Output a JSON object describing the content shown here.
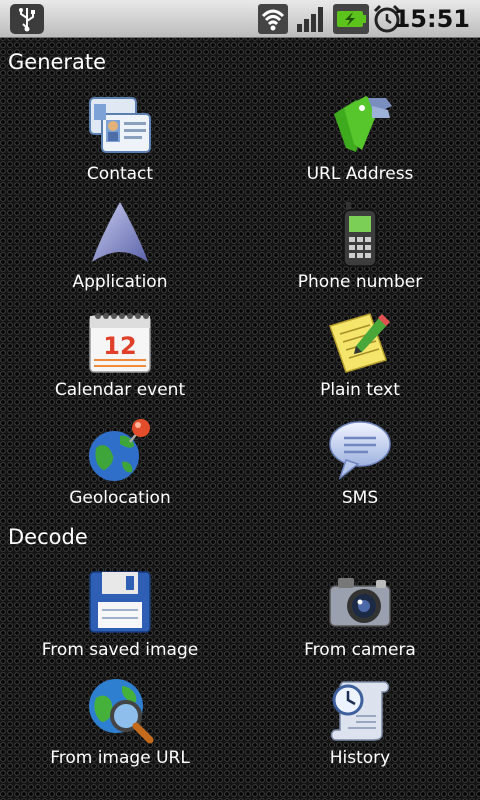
{
  "status_bar": {
    "time": "15:51",
    "icons": [
      "usb-icon",
      "wifi-icon",
      "signal-icon",
      "battery-charging-icon",
      "alarm-clock-icon"
    ]
  },
  "sections": {
    "generate_title": "Generate",
    "decode_title": "Decode"
  },
  "generate": {
    "contact": "Contact",
    "url": "URL Address",
    "application": "Application",
    "phone": "Phone number",
    "calendar": "Calendar event",
    "calendar_day": "12",
    "plain_text": "Plain text",
    "geolocation": "Geolocation",
    "sms": "SMS"
  },
  "decode": {
    "saved_image": "From saved image",
    "camera": "From camera",
    "image_url": "From image URL",
    "history": "History"
  },
  "colors": {
    "background": "#141414",
    "status_bar": "#d4d4d4",
    "text": "#ffffff",
    "battery_green": "#5cc21c"
  }
}
